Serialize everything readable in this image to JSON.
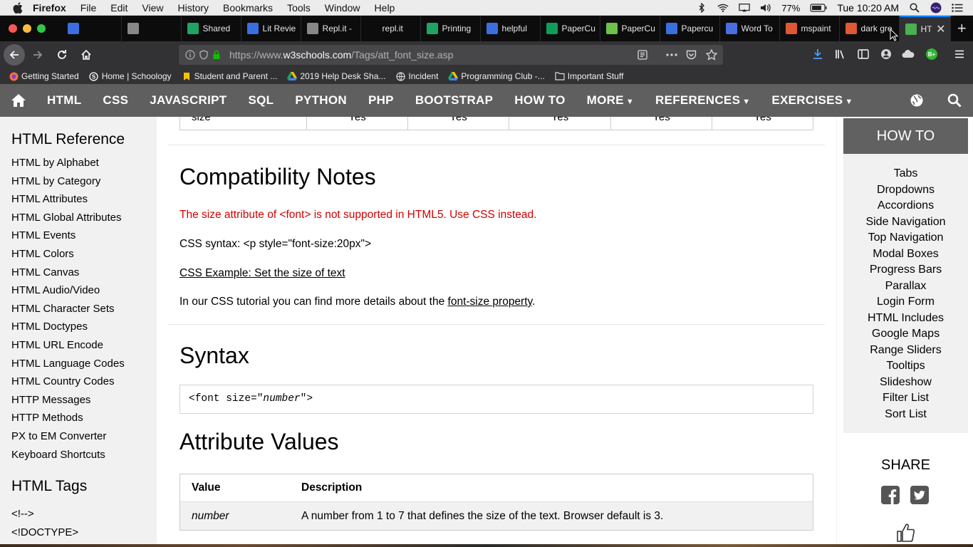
{
  "menubar": {
    "app": "Firefox",
    "items": [
      "File",
      "Edit",
      "View",
      "History",
      "Bookmarks",
      "Tools",
      "Window",
      "Help"
    ],
    "battery": "77%",
    "clock": "Tue 10:20 AM"
  },
  "tabs": [
    {
      "title": "",
      "icon": "google-docs-icon",
      "color": "#3b6fe0"
    },
    {
      "title": "",
      "icon": "replit-icon",
      "color": "#888"
    },
    {
      "title": "Shared",
      "icon": "google-drive-icon",
      "color": "#1fa463"
    },
    {
      "title": "Lit Revie",
      "icon": "google-docs-icon",
      "color": "#3b6fe0"
    },
    {
      "title": "Repl.it -",
      "icon": "replit-icon",
      "color": "#888"
    },
    {
      "title": "repl.it",
      "icon": "blank-icon",
      "color": "#0c0c0d"
    },
    {
      "title": "Printing",
      "icon": "google-drive-icon",
      "color": "#1fa463"
    },
    {
      "title": "helpful",
      "icon": "google-docs-icon",
      "color": "#3b6fe0"
    },
    {
      "title": "PaperCu",
      "icon": "google-sheets-icon",
      "color": "#0f9d58"
    },
    {
      "title": "PaperCu",
      "icon": "papercut-icon",
      "color": "#6cc24a"
    },
    {
      "title": "Papercu",
      "icon": "google-docs-icon",
      "color": "#3b6fe0"
    },
    {
      "title": "Word To",
      "icon": "gear-icon",
      "color": "#4a6ee0"
    },
    {
      "title": "mspaint",
      "icon": "duckduckgo-icon",
      "color": "#de5833"
    },
    {
      "title": "dark gre",
      "icon": "duckduckgo-icon",
      "color": "#de5833"
    },
    {
      "title": "HTM",
      "icon": "w3schools-icon",
      "color": "#4caf50",
      "active": true
    }
  ],
  "url": {
    "prefix": "https://www.",
    "host": "w3schools.com",
    "path": "/Tags/att_font_size.asp"
  },
  "bookmarks": [
    {
      "label": "Getting Started",
      "icon": "firefox-icon"
    },
    {
      "label": "Home | Schoology",
      "icon": "schoology-icon"
    },
    {
      "label": "Student and Parent ...",
      "icon": "bookmark-icon"
    },
    {
      "label": "2019 Help Desk Sha...",
      "icon": "google-drive-icon"
    },
    {
      "label": "Incident",
      "icon": "globe-icon"
    },
    {
      "label": "Programming Club -...",
      "icon": "google-drive-icon"
    },
    {
      "label": "Important Stuff",
      "icon": "folder-icon"
    }
  ],
  "w3nav": {
    "items": [
      "HTML",
      "CSS",
      "JAVASCRIPT",
      "SQL",
      "PYTHON",
      "PHP",
      "BOOTSTRAP",
      "HOW TO"
    ],
    "dropdowns": [
      "MORE",
      "REFERENCES",
      "EXERCISES"
    ]
  },
  "leftnav": {
    "heading": "HTML Reference",
    "items": [
      "HTML by Alphabet",
      "HTML by Category",
      "HTML Attributes",
      "HTML Global Attributes",
      "HTML Events",
      "HTML Colors",
      "HTML Canvas",
      "HTML Audio/Video",
      "HTML Character Sets",
      "HTML Doctypes",
      "HTML URL Encode",
      "HTML Language Codes",
      "HTML Country Codes",
      "HTTP Messages",
      "HTTP Methods",
      "PX to EM Converter",
      "Keyboard Shortcuts"
    ],
    "heading2": "HTML Tags",
    "tags": [
      "<!-->",
      "<!DOCTYPE>"
    ]
  },
  "main": {
    "support_row": {
      "attr": "size",
      "cells": [
        "Yes",
        "Yes",
        "Yes",
        "Yes",
        "Yes"
      ]
    },
    "compat_title": "Compatibility Notes",
    "compat_warning": "The size attribute of <font> is not supported in HTML5. Use CSS instead.",
    "css_syntax": "CSS syntax: <p style=\"font-size:20px\">",
    "css_example_link": "CSS Example: Set the size of text",
    "tutorial_prefix": "In our CSS tutorial you can find more details about the ",
    "tutorial_link": "font-size property",
    "tutorial_suffix": ".",
    "syntax_title": "Syntax",
    "syntax_code_pre": "<font size=\"",
    "syntax_code_var": "number",
    "syntax_code_post": "\">",
    "values_title": "Attribute Values",
    "values_table": {
      "headers": [
        "Value",
        "Description"
      ],
      "rows": [
        [
          "number",
          "A number from 1 to 7 that defines the size of the text. Browser default is 3."
        ]
      ]
    }
  },
  "right": {
    "howto_title": "HOW TO",
    "howto_items": [
      "Tabs",
      "Dropdowns",
      "Accordions",
      "Side Navigation",
      "Top Navigation",
      "Modal Boxes",
      "Progress Bars",
      "Parallax",
      "Login Form",
      "HTML Includes",
      "Google Maps",
      "Range Sliders",
      "Tooltips",
      "Slideshow",
      "Filter List",
      "Sort List"
    ],
    "share_title": "SHARE"
  }
}
